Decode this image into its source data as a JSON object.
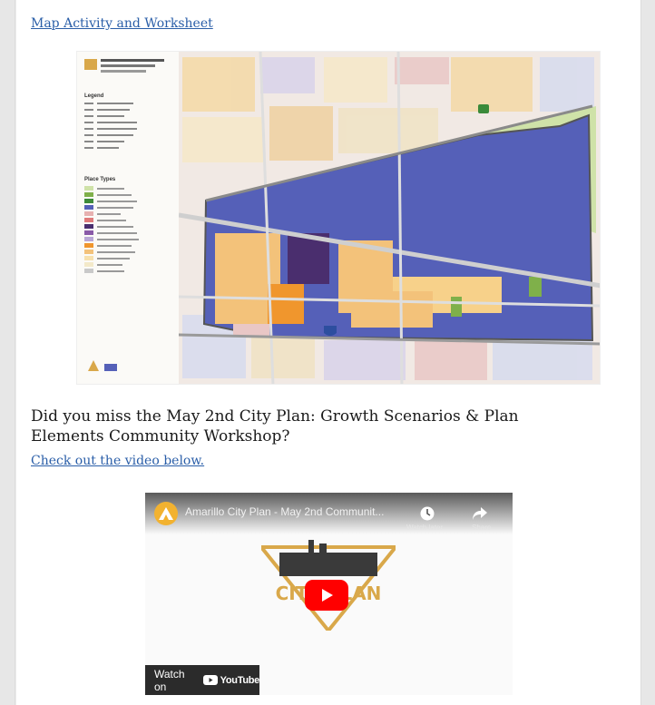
{
  "links": {
    "map_activity": "Map Activity and Worksheet",
    "check_video": "Check out the video below."
  },
  "map": {
    "legend_heading": "Legend",
    "place_types_heading": "Place Types"
  },
  "headline": "Did you miss the May 2nd City Plan: Growth Scenarios & Plan Elements Community Workshop?",
  "video": {
    "title": "Amarillo City Plan - May 2nd Communit...",
    "watch_later_label": "Watch later",
    "share_label": "Share",
    "watch_on_label": "Watch on",
    "youtube_word": "YouTube",
    "logo_text": "CITY PLAN"
  },
  "colors": {
    "link": "#2a5ea8",
    "play_red": "#ff0000",
    "logo_gold": "#d9a84a"
  }
}
